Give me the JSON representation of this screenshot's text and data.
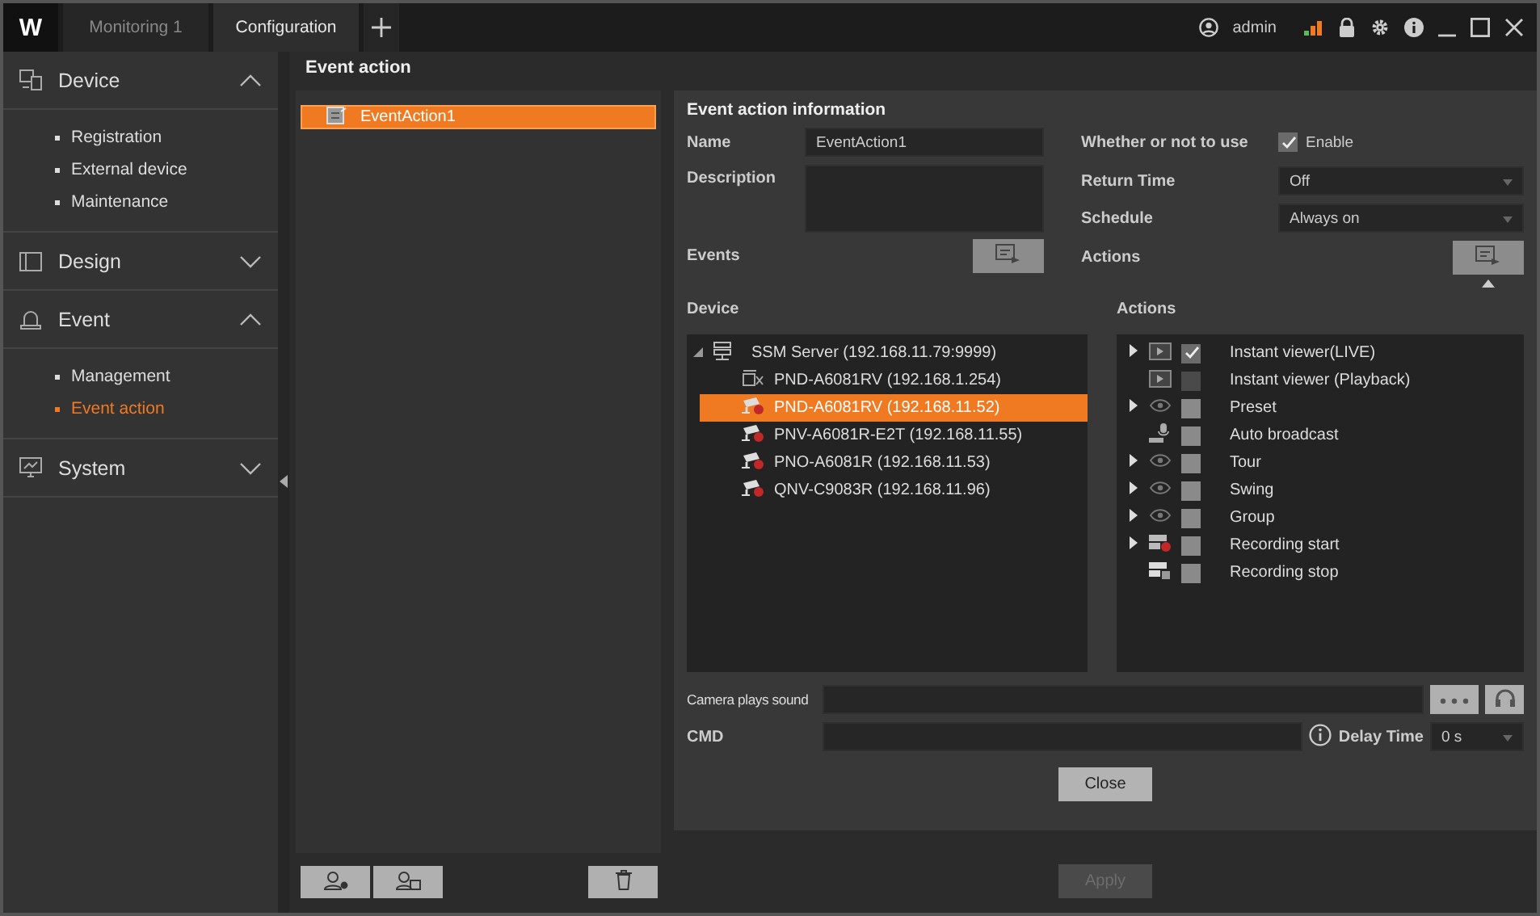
{
  "app": {
    "logo": "W",
    "user": "admin"
  },
  "tabs": [
    {
      "label": "Monitoring 1",
      "selected": false
    },
    {
      "label": "Configuration",
      "selected": true
    }
  ],
  "sidebar": {
    "sections": [
      {
        "label": "Device",
        "expanded": true,
        "items": [
          {
            "label": "Registration",
            "selected": false
          },
          {
            "label": "External device",
            "selected": false
          },
          {
            "label": "Maintenance",
            "selected": false
          }
        ]
      },
      {
        "label": "Design",
        "expanded": false
      },
      {
        "label": "Event",
        "expanded": true,
        "items": [
          {
            "label": "Management",
            "selected": false
          },
          {
            "label": "Event action",
            "selected": true
          }
        ]
      },
      {
        "label": "System",
        "expanded": false
      }
    ]
  },
  "event_list": {
    "title": "Event action",
    "items": [
      {
        "label": "EventAction1",
        "selected": true
      }
    ]
  },
  "info": {
    "title": "Event action information",
    "name_label": "Name",
    "name_value": "EventAction1",
    "description_label": "Description",
    "events_label": "Events",
    "use_label": "Whether or not to use",
    "enable": {
      "label": "Enable",
      "checked": true
    },
    "return_time": {
      "label": "Return Time",
      "value": "Off"
    },
    "schedule": {
      "label": "Schedule",
      "value": "Always on"
    },
    "actions_label": "Actions"
  },
  "device": {
    "title": "Device",
    "tree": [
      {
        "label": "SSM Server (192.168.11.79:9999)",
        "expanded": true,
        "selected": false,
        "children": [
          {
            "label": "PND-A6081RV (192.168.1.254)",
            "kind": "offline",
            "selected": false
          },
          {
            "label": "PND-A6081RV (192.168.11.52)",
            "kind": "camera",
            "selected": true
          },
          {
            "label": "PNV-A6081R-E2T (192.168.11.55)",
            "kind": "camera",
            "selected": false
          },
          {
            "label": "PNO-A6081R (192.168.11.53)",
            "kind": "camera",
            "selected": false
          },
          {
            "label": "QNV-C9083R (192.168.11.96)",
            "kind": "camera",
            "selected": false
          }
        ]
      }
    ]
  },
  "actions": {
    "title": "Actions",
    "items": [
      {
        "label": "Instant viewer(LIVE)",
        "kind": "viewer",
        "expandable": true,
        "checked": true,
        "disabled": false
      },
      {
        "label": "Instant viewer (Playback)",
        "kind": "viewer",
        "expandable": false,
        "checked": false,
        "disabled": true
      },
      {
        "label": "Preset",
        "kind": "eye",
        "expandable": true,
        "checked": false,
        "disabled": false
      },
      {
        "label": "Auto broadcast",
        "kind": "broadcast",
        "expandable": false,
        "checked": false,
        "disabled": false
      },
      {
        "label": "Tour",
        "kind": "eye",
        "expandable": true,
        "checked": false,
        "disabled": false
      },
      {
        "label": "Swing",
        "kind": "eye",
        "expandable": true,
        "checked": false,
        "disabled": false
      },
      {
        "label": "Group",
        "kind": "eye",
        "expandable": true,
        "checked": false,
        "disabled": false
      },
      {
        "label": "Recording start",
        "kind": "record_start",
        "expandable": true,
        "checked": false,
        "disabled": false
      },
      {
        "label": "Recording stop",
        "kind": "record_stop",
        "expandable": false,
        "checked": false,
        "disabled": false
      }
    ]
  },
  "sound": {
    "label": "Camera plays sound"
  },
  "cmd": {
    "label": "CMD"
  },
  "delay": {
    "label": "Delay Time",
    "value": "0 s"
  },
  "close": {
    "label": "Close"
  },
  "apply": {
    "label": "Apply",
    "disabled": true
  }
}
